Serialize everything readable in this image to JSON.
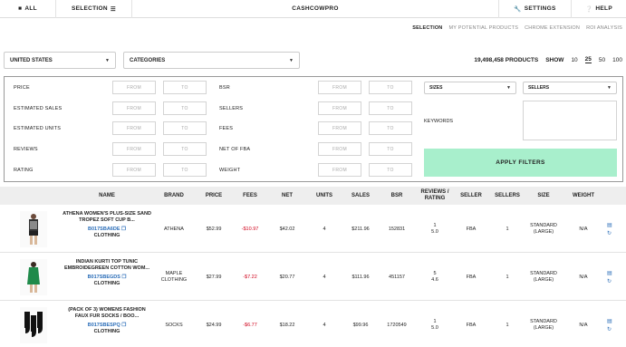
{
  "nav": {
    "all": "ALL",
    "selection": "SELECTION",
    "title": "CASHCOWPRO",
    "settings": "SETTINGS",
    "help": "HELP"
  },
  "subnav": [
    "SELECTION",
    "MY POTENTIAL PRODUCTS",
    "CHROME EXTENSION",
    "ROI ANALYSIS"
  ],
  "country": "UNITED STATES",
  "categories": "CATEGORIES",
  "products_count": "19,498,458 PRODUCTS",
  "show_label": "SHOW",
  "show_options": [
    "10",
    "25",
    "50",
    "100"
  ],
  "show_selected": "25",
  "filters": {
    "from": "FROM",
    "to": "TO",
    "left": [
      "PRICE",
      "ESTIMATED SALES",
      "ESTIMATED UNITS",
      "REVIEWS",
      "RATING"
    ],
    "right": [
      "BSR",
      "SELLERS",
      "FEES",
      "NET OF FBA",
      "WEIGHT"
    ],
    "sizes": "SIZES",
    "sellers": "SELLERS",
    "keywords": "KEYWORDS",
    "apply": "APPLY FILTERS"
  },
  "columns": [
    "NAME",
    "BRAND",
    "PRICE",
    "FEES",
    "NET",
    "UNITS",
    "SALES",
    "BSR",
    "REVIEWS /\nRATING",
    "SELLER",
    "SELLERS",
    "SIZE",
    "WEIGHT"
  ],
  "rows": [
    {
      "name": "ATHENA WOMEN'S PLUS-SIZE SAND TROPEZ SOFT CUP B...",
      "asin": "B017SBA6DE",
      "category": "CLOTHING",
      "brand": "ATHENA",
      "price": "$52.99",
      "fees": "-$10.97",
      "net": "$42.02",
      "units": "4",
      "sales": "$211.96",
      "bsr": "152831",
      "reviews": "1",
      "rating": "5.0",
      "seller": "FBA",
      "sellers": "1",
      "size": "STANDARD\n(LARGE)",
      "weight": "N/A",
      "thumb": "tankini"
    },
    {
      "name": "INDIAN KURTI TOP TUNIC EMBROIDEGREEN COTTON WOM...",
      "asin": "B017SBEGDS",
      "category": "CLOTHING",
      "brand": "MAPLE\nCLOTHING",
      "price": "$27.99",
      "fees": "-$7.22",
      "net": "$20.77",
      "units": "4",
      "sales": "$111.96",
      "bsr": "451157",
      "reviews": "5",
      "rating": "4.6",
      "seller": "FBA",
      "sellers": "1",
      "size": "STANDARD\n(LARGE)",
      "weight": "N/A",
      "thumb": "kurti"
    },
    {
      "name": "(PACK OF 3) WOMENS FASHION FAUX FUR SOCKS / BOO...",
      "asin": "B017SBESPQ",
      "category": "CLOTHING",
      "brand": "SOCKS",
      "price": "$24.99",
      "fees": "-$6.77",
      "net": "$18.22",
      "units": "4",
      "sales": "$99.96",
      "bsr": "1720549",
      "reviews": "1",
      "rating": "5.0",
      "seller": "FBA",
      "sellers": "1",
      "size": "STANDARD\n(LARGE)",
      "weight": "N/A",
      "thumb": "socks"
    }
  ]
}
